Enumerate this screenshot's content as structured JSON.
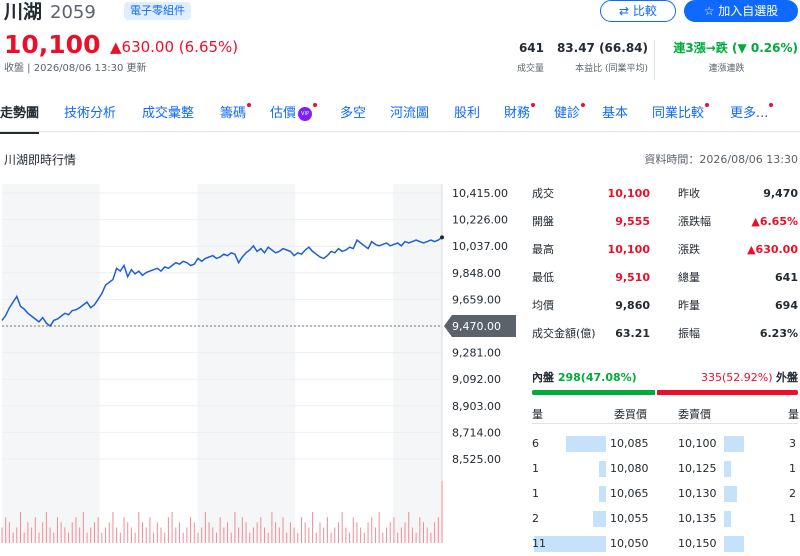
{
  "header": {
    "name": "川湖",
    "code": "2059",
    "tag": "電子零組件",
    "compare_label": "比較",
    "watchlist_label": "加入自選股",
    "price": "10,100",
    "change": "▲630.00 (6.65%)",
    "close_time": "收盤 | 2026/08/06 13:30 更新"
  },
  "stats": {
    "volume": {
      "value": "641",
      "label": "成交量"
    },
    "pe": {
      "value": "83.47 (66.84)",
      "label": "本益比 (同業平均)"
    },
    "streak": {
      "value": "連3漲→跌 (▼ 0.26%)",
      "label": "連漲連跌"
    }
  },
  "tabs": [
    {
      "label": "走勢圖",
      "active": true,
      "dot": false
    },
    {
      "label": "技術分析",
      "dot": false
    },
    {
      "label": "成交彙整",
      "dot": false
    },
    {
      "label": "籌碼",
      "dot": true
    },
    {
      "label": "估價",
      "dot": true,
      "vip": "VIP"
    },
    {
      "label": "多空",
      "dot": false
    },
    {
      "label": "河流圖",
      "dot": false
    },
    {
      "label": "股利",
      "dot": false
    },
    {
      "label": "財務",
      "dot": true
    },
    {
      "label": "健診",
      "dot": true
    },
    {
      "label": "基本",
      "dot": false
    },
    {
      "label": "同業比較",
      "dot": true
    },
    {
      "label": "更多...",
      "dot": true
    }
  ],
  "section": {
    "title": "川湖即時行情",
    "data_time": "資料時間：2026/08/06 13:30"
  },
  "quote_table": [
    {
      "l1": "成交",
      "v1": "10,100",
      "c1": "red",
      "l2": "昨收",
      "v2": "9,470",
      "c2": ""
    },
    {
      "l1": "開盤",
      "v1": "9,555",
      "c1": "red",
      "l2": "漲跌幅",
      "v2": "▲6.65%",
      "c2": "red"
    },
    {
      "l1": "最高",
      "v1": "10,100",
      "c1": "red",
      "l2": "漲跌",
      "v2": "▲630.00",
      "c2": "red"
    },
    {
      "l1": "最低",
      "v1": "9,510",
      "c1": "red",
      "l2": "總量",
      "v2": "641",
      "c2": ""
    },
    {
      "l1": "均價",
      "v1": "9,860",
      "c1": "",
      "l2": "昨量",
      "v2": "694",
      "c2": ""
    },
    {
      "l1": "成交金額(億)",
      "v1": "63.21",
      "c1": "",
      "l2": "振幅",
      "v2": "6.23%",
      "c2": ""
    }
  ],
  "bid_ask": {
    "inner_label": "內盤",
    "inner_value": "298(47.08%)",
    "outer_value": "335(52.92%)",
    "outer_label": "外盤",
    "inner_ratio": 0.4708
  },
  "order_book": {
    "headers": {
      "qty": "量",
      "bid": "委買價",
      "ask": "委賣價",
      "qty2": "量"
    },
    "rows": [
      {
        "bid_qty": "6",
        "bid": "10,085",
        "ask": "10,100",
        "ask_qty": "3",
        "bid_level": 6,
        "ask_level": 3
      },
      {
        "bid_qty": "1",
        "bid": "10,080",
        "ask": "10,125",
        "ask_qty": "1",
        "bid_level": 1,
        "ask_level": 1
      },
      {
        "bid_qty": "1",
        "bid": "10,065",
        "ask": "10,130",
        "ask_qty": "2",
        "bid_level": 1,
        "ask_level": 2
      },
      {
        "bid_qty": "2",
        "bid": "10,055",
        "ask": "10,135",
        "ask_qty": "1",
        "bid_level": 2,
        "ask_level": 1
      },
      {
        "bid_qty": "11",
        "bid": "10,050",
        "ask": "10,150",
        "ask_qty": "",
        "bid_level": 11,
        "ask_level": 3
      }
    ]
  },
  "colors": {
    "up": "#eb0f29",
    "down": "#00aa3b",
    "line": "#1f5fd6",
    "accent": "#0f69ff"
  },
  "chart_data": {
    "type": "line",
    "y_ticks": [
      "10,415.00",
      "10,226.00",
      "10,037.00",
      "9,848.00",
      "9,659.00",
      "9,470.00",
      "9,281.00",
      "9,092.00",
      "8,903.00",
      "8,714.00",
      "8,525.00"
    ],
    "ylim": [
      8525,
      10415
    ],
    "prev_close": 9470,
    "prev_close_label": "9,470.00",
    "values": [
      9510,
      9545,
      9600,
      9640,
      9680,
      9610,
      9590,
      9560,
      9540,
      9520,
      9500,
      9530,
      9490,
      9470,
      9510,
      9520,
      9540,
      9560,
      9550,
      9580,
      9585,
      9600,
      9620,
      9640,
      9600,
      9620,
      9660,
      9700,
      9760,
      9780,
      9800,
      9880,
      9860,
      9900,
      9820,
      9870,
      9840,
      9860,
      9830,
      9850,
      9860,
      9870,
      9880,
      9860,
      9890,
      9880,
      9900,
      9920,
      9910,
      9930,
      9920,
      9900,
      9910,
      9950,
      9930,
      9950,
      9960,
      9970,
      9950,
      9960,
      9980,
      9970,
      9990,
      9980,
      9920,
      9960,
      9990,
      10010,
      10040,
      10000,
      10020,
      9990,
      10030,
      10010,
      9990,
      10000,
      10020,
      10010,
      10000,
      9970,
      9990,
      9980,
      10010,
      10030,
      10000,
      9980,
      9960,
      9950,
      9970,
      10000,
      9990,
      10020,
      10000,
      10010,
      10030,
      10020,
      10080,
      10060,
      10040,
      10020,
      10070,
      10050,
      10040,
      10050,
      10060,
      10040,
      10050,
      10060,
      10040,
      10070,
      10060,
      10070,
      10080,
      10070,
      10060,
      10070,
      10080,
      10070,
      10080,
      10100
    ],
    "volumes": [
      3,
      5,
      4,
      2,
      3,
      6,
      2,
      4,
      3,
      5,
      2,
      4,
      6,
      3,
      2,
      5,
      4,
      3,
      2,
      4,
      5,
      3,
      6,
      2,
      3,
      4,
      5,
      2,
      3,
      4,
      6,
      3,
      2,
      5,
      4,
      3,
      2,
      6,
      4,
      3,
      5,
      2,
      4,
      3,
      2,
      5,
      6,
      3,
      4,
      2,
      3,
      5,
      4,
      2,
      3,
      6,
      4,
      3,
      2,
      5,
      3,
      4,
      2,
      6,
      3,
      5,
      4,
      2,
      3,
      4,
      5,
      3,
      2,
      6,
      4,
      3,
      5,
      2,
      4,
      3,
      2,
      5,
      4,
      3,
      6,
      2,
      4,
      3,
      5,
      2,
      3,
      4,
      6,
      3,
      2,
      5,
      4,
      3,
      2,
      4,
      5,
      3,
      6,
      2,
      3,
      4,
      5,
      2,
      3,
      4,
      6,
      3,
      2,
      5,
      4,
      3,
      2,
      4,
      5,
      12
    ]
  }
}
